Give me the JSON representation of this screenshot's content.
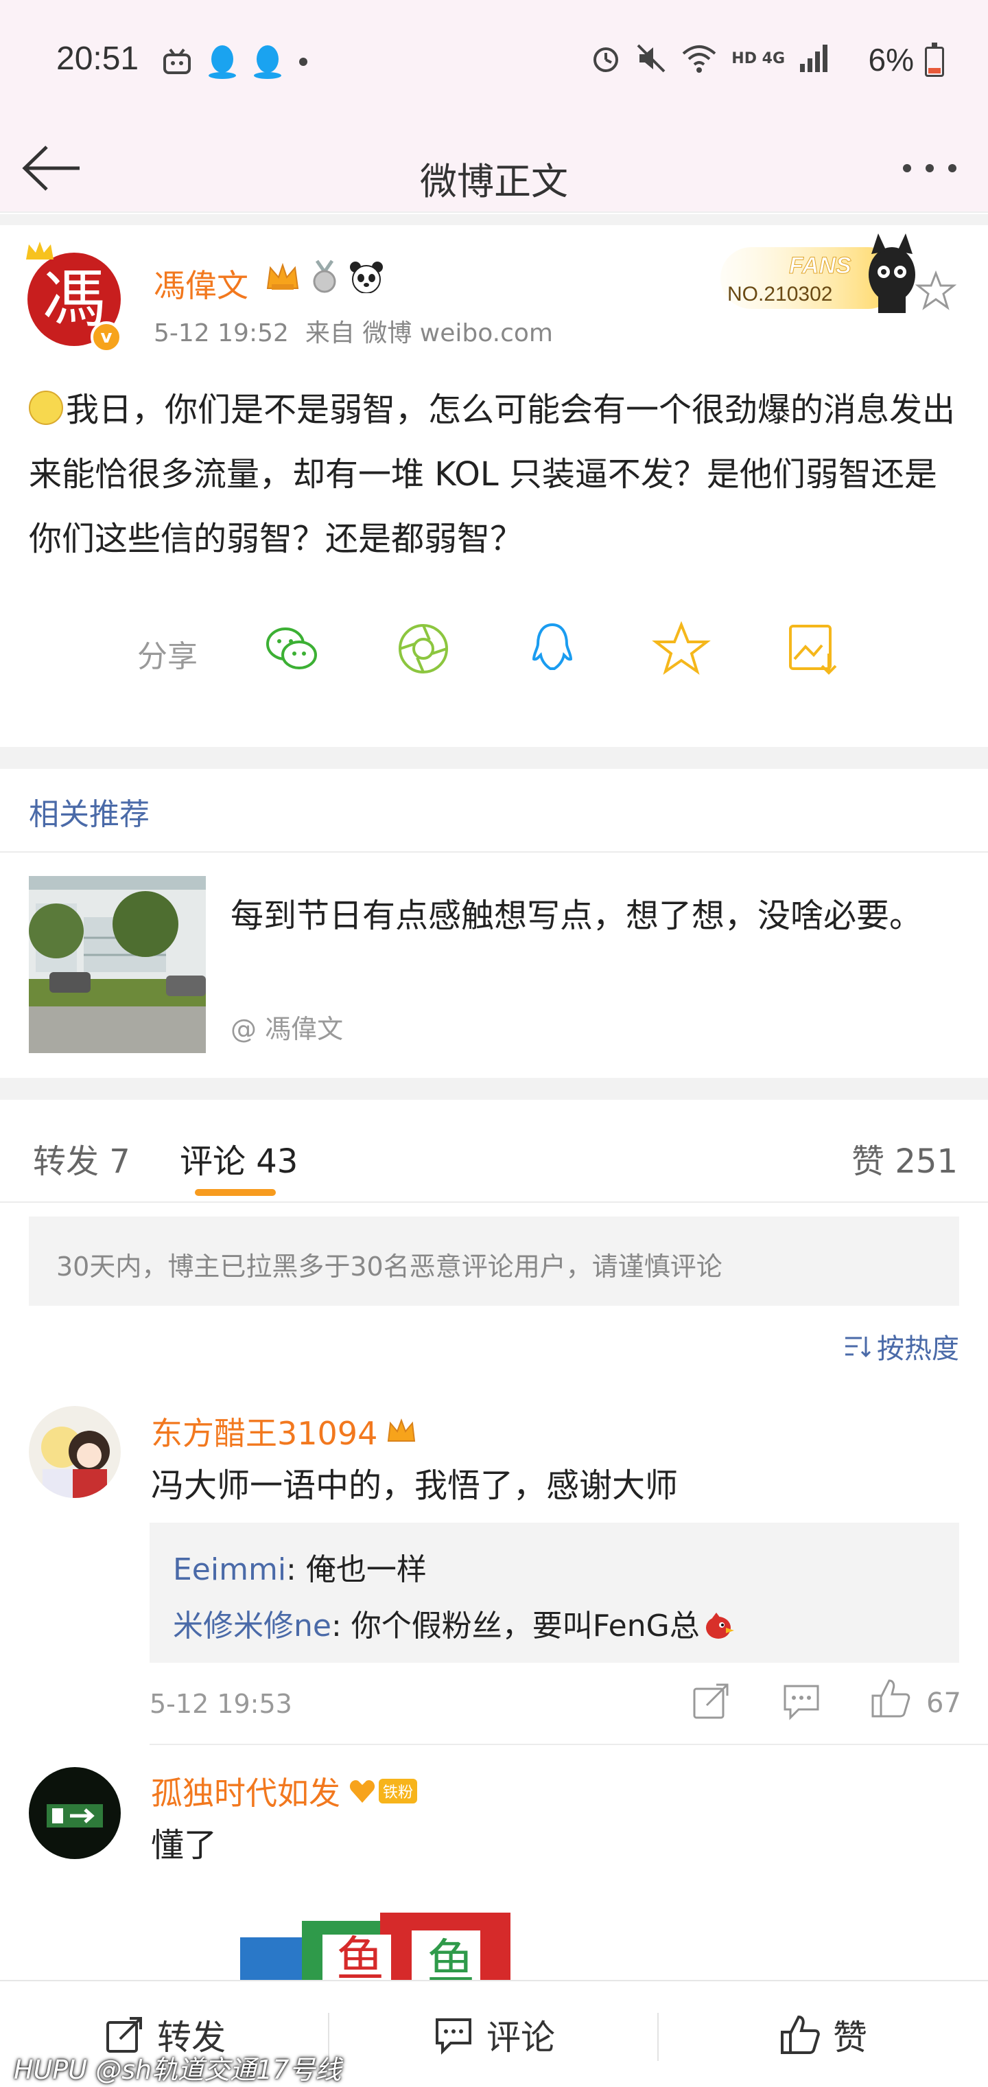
{
  "status_bar": {
    "time": "20:51",
    "battery": "6%",
    "network": "HD 4G"
  },
  "nav": {
    "title": "微博正文"
  },
  "post": {
    "author": "馮偉文",
    "avatar_char": "馮",
    "verified": "v",
    "date": "5-12 19:52",
    "source": "来自 微博 weibo.com",
    "fans_label": "FANS",
    "fans_no": "NO.210302",
    "text": "我日，你们是不是弱智，怎么可能会有一个很劲爆的消息发出来能恰很多流量，却有一堆 KOL 只装逼不发？是他们弱智还是你们这些信的弱智？还是都弱智？",
    "share_label": "分享"
  },
  "related": {
    "title": "相关推荐",
    "item_text": "每到节日有点感触想写点，想了想，没啥必要。",
    "item_author": "@ 馮偉文"
  },
  "tabs": {
    "repost": "转发 7",
    "comment": "评论 43",
    "like": "赞 251"
  },
  "notice": "30天内，博主已拉黑多于30名恶意评论用户，请谨慎评论",
  "sort_label": "按热度",
  "comments": [
    {
      "name": "东方醋王31094",
      "text": "冯大师一语中的，我悟了，感谢大师",
      "replies": [
        {
          "name": "Eeimmi",
          "text": ": 俺也一样"
        },
        {
          "name": "米修米修ne",
          "text": ": 你个假粉丝，要叫FenG总"
        }
      ],
      "time": "5-12 19:53",
      "likes": "67"
    },
    {
      "name": "孤独时代如发",
      "badge": "铁粉",
      "text": "懂了"
    }
  ],
  "bottom_bar": {
    "repost": "转发",
    "comment": "评论",
    "like": "赞"
  },
  "watermark": "HUPU @sh轨道交通17号线",
  "colors": {
    "accent_orange": "#f2781e",
    "link_blue": "#4a6aa8",
    "tab_underline": "#f79b1e"
  }
}
